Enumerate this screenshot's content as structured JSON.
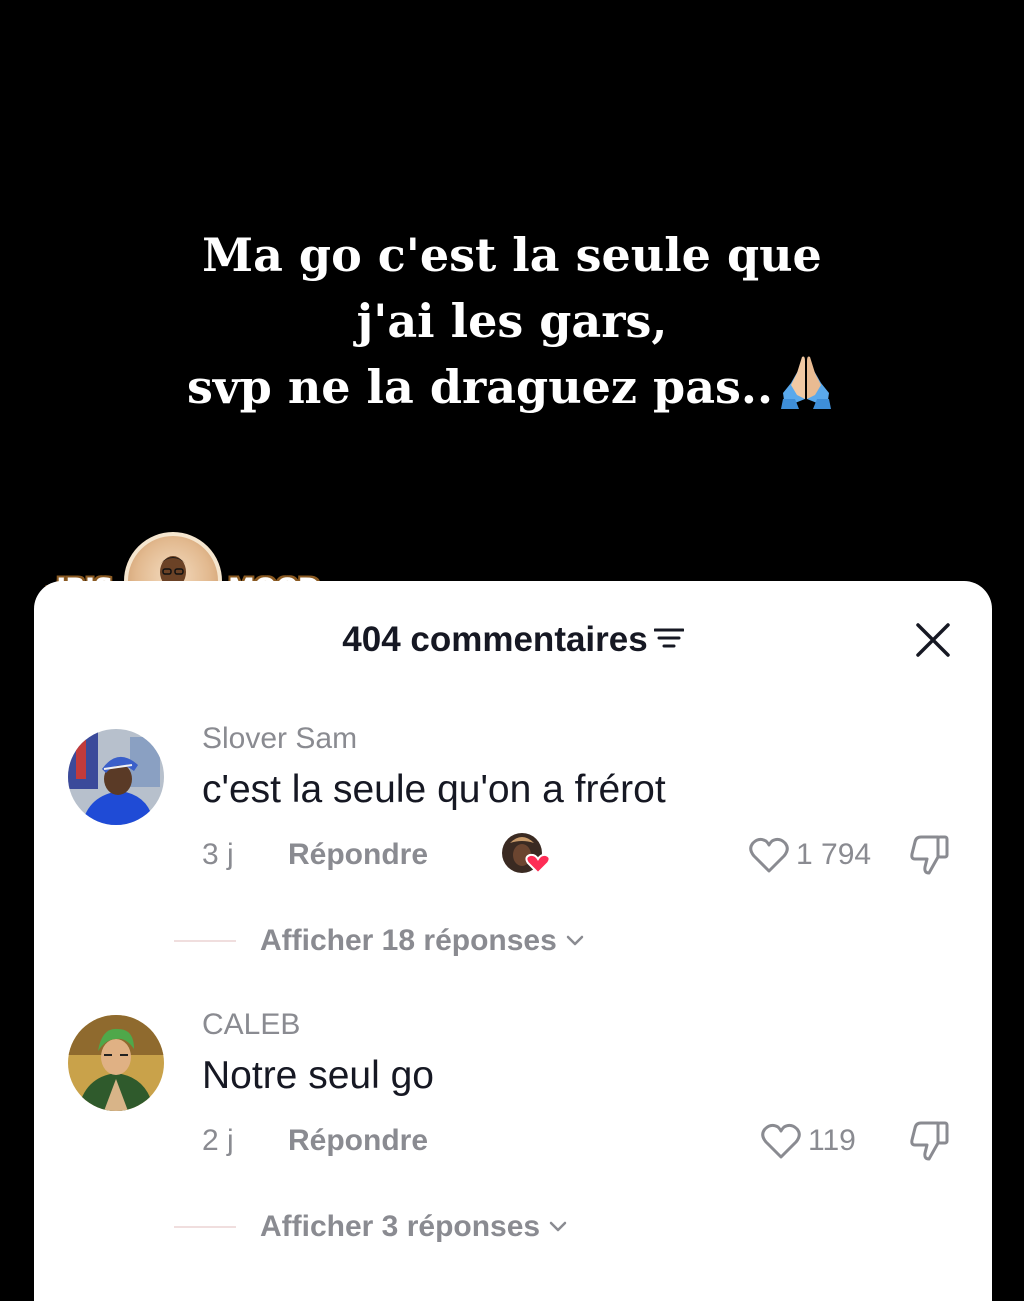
{
  "caption": {
    "line1": "Ma go c'est la seule que",
    "line2": "j'ai les gars,",
    "line3": "svp ne la draguez pas..",
    "emoji": "folded-hands-emoji"
  },
  "watermark": {
    "left": "-IRIS",
    "right": "MOOD-"
  },
  "sheet": {
    "title": "404 commentaires",
    "filter_icon": "filter-icon",
    "close_icon": "close-icon"
  },
  "comments": [
    {
      "username": "Slover Sam",
      "text": "c'est la seule qu'on a frérot",
      "time": "3 j",
      "reply_label": "Répondre",
      "creator_liked": true,
      "likes": "1 794",
      "view_replies": "Afficher 18 réponses"
    },
    {
      "username": "CALEB",
      "text": "Notre seul go",
      "time": "2 j",
      "reply_label": "Répondre",
      "creator_liked": false,
      "likes": "119",
      "view_replies": "Afficher 3 réponses"
    }
  ],
  "colors": {
    "background": "#000000",
    "sheet": "#ffffff",
    "primary_text": "#161823",
    "secondary_text": "#8a8b91",
    "heart_accent": "#fe2c55"
  }
}
